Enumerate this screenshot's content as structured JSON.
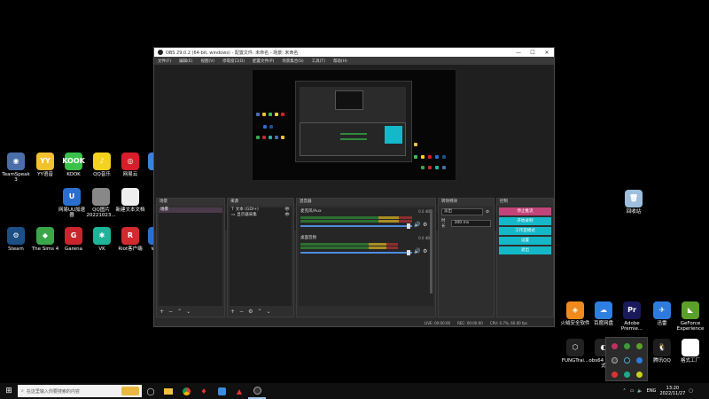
{
  "desktop_icons_left": [
    {
      "label": "TeamSpeak 3",
      "color": "#4a6ea8",
      "glyph": "◉"
    },
    {
      "label": "YY语音",
      "color": "#f2c12e",
      "glyph": "YY"
    },
    {
      "label": "KOOK",
      "color": "#3ac14a",
      "glyph": "KOOK"
    },
    {
      "label": "QQ音乐",
      "color": "#f5d21e",
      "glyph": "♪"
    },
    {
      "label": "网易云",
      "color": "#d81e2a",
      "glyph": "◎"
    },
    {
      "label": "",
      "color": "#3b83d9",
      "glyph": "C"
    },
    {
      "label": "网易UU加速器",
      "color": "#2a6fcf",
      "glyph": "U"
    },
    {
      "label": "QQ图片20221023...",
      "color": "#888888",
      "glyph": ""
    },
    {
      "label": "新建文本文档",
      "color": "#eeeeee",
      "glyph": ""
    },
    {
      "label": "Steam",
      "color": "#1b4f86",
      "glyph": "⚙"
    },
    {
      "label": "The Sims 4",
      "color": "#3aa64a",
      "glyph": "◆"
    },
    {
      "label": "Garena",
      "color": "#c8262c",
      "glyph": "G"
    },
    {
      "label": "VK",
      "color": "#1fb49a",
      "glyph": "✱"
    },
    {
      "label": "Riot客户端",
      "color": "#d12a2f",
      "glyph": "R"
    },
    {
      "label": "WeG",
      "color": "#2a6fcf",
      "glyph": "W"
    }
  ],
  "desktop_icons_right": [
    {
      "label": "回收站",
      "color": "#9dbedc",
      "glyph": "🗑"
    },
    {
      "label": "火绒安全软件",
      "color": "#f08a1c",
      "glyph": "◈"
    },
    {
      "label": "百度网盘",
      "color": "#2f7fe0",
      "glyph": "☁"
    },
    {
      "label": "Adobe Premie...",
      "color": "#1a1a5a",
      "glyph": "Pr"
    },
    {
      "label": "迅雷",
      "color": "#2e7be0",
      "glyph": "✈"
    },
    {
      "label": "GeForce Experience",
      "color": "#5aa02a",
      "glyph": "◣"
    },
    {
      "label": "FUNGTrai...",
      "color": "#222222",
      "glyph": "⬡"
    },
    {
      "label": "obs64 - 捷方式",
      "color": "#222222",
      "glyph": "◐"
    },
    {
      "label": "腾讯QQ",
      "color": "#1d1d1d",
      "glyph": "🐧"
    },
    {
      "label": "格式工厂",
      "color": "#ffffff",
      "glyph": "◍"
    }
  ],
  "obs": {
    "title": "OBS 29.0.2 (64-bit, windows) - 配置文件: 未命名 - 场景: 未命名",
    "window_controls": [
      "—",
      "☐",
      "✕"
    ],
    "menu": [
      "文件(F)",
      "编辑(E)",
      "视图(V)",
      "停靠窗口(D)",
      "配置文件(P)",
      "场景集合(S)",
      "工具(T)",
      "帮助(H)"
    ],
    "no_source_selected": "未选择源",
    "props_button": "属性",
    "filter_button": "滤镜",
    "docks": {
      "scenes_title": "场景",
      "scene_items": [
        "场景"
      ],
      "sources_title": "来源",
      "source_items": [
        "文本 (GDI+)",
        "显示器采集"
      ],
      "mixer_title": "混音器",
      "mixer_channels": [
        {
          "name": "麦克风/Aux",
          "db": "0.0 dB",
          "level": 0.85
        },
        {
          "name": "桌面音频",
          "db": "0.0 dB",
          "level": 0.8
        }
      ],
      "transitions_title": "转场特效",
      "transition_type": "淡出",
      "duration_label": "时长",
      "duration_value": "300 ms",
      "controls_title": "控制",
      "controls_buttons": [
        "停止推流",
        "开始录制",
        "工作室模式",
        "设置",
        "退出"
      ]
    },
    "statusbar": {
      "live": "LIVE: 00:00:00",
      "rec": "REC: 00:00:00",
      "cpu": "CPU: 0.7%, 60.00 fps"
    }
  },
  "taskbar": {
    "search_placeholder": "在这里输入你要搜索的内容",
    "start_icon": "windows-icon",
    "apps": [
      "task-view-icon",
      "file-explorer-icon",
      "chrome-icon",
      "app-red-icon",
      "bluetooth-app-icon",
      "media-icon",
      "obs-icon"
    ],
    "lang": "ENG",
    "time": "13:20",
    "date": "2022/11/27"
  }
}
